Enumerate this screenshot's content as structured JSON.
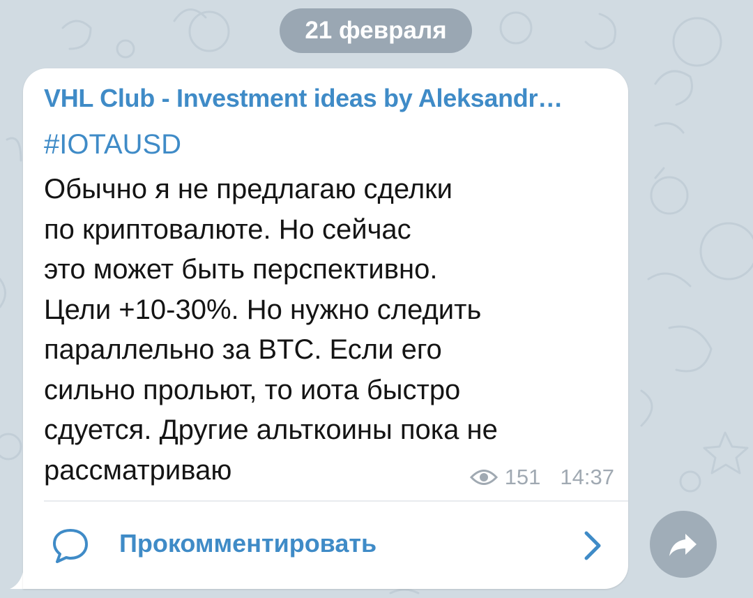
{
  "date_label": "21 февраля",
  "post": {
    "channel_name": "VHL Club - Investment ideas by Aleksandr…",
    "hashtag": "#IOTAUSD",
    "lines": [
      "Обычно я не предлагаю сделки",
      "по криптовалюте. Но сейчас",
      "это может быть перспективно.",
      "Цели +10-30%. Но нужно следить",
      "параллельно за BTC. Если его",
      "сильно прольют, то иота быстро",
      "сдуется. Другие альткоины пока не",
      "рассматриваю"
    ],
    "views": "151",
    "time": "14:37",
    "comment_label": "Прокомментировать"
  },
  "colors": {
    "background": "#d1dbe2",
    "accent": "#3f8bc7",
    "meta": "#a0a9b2"
  },
  "icons": {
    "views": "eye-icon",
    "comment": "speech-bubble-icon",
    "chevron": "chevron-right-icon",
    "share": "share-arrow-icon"
  }
}
